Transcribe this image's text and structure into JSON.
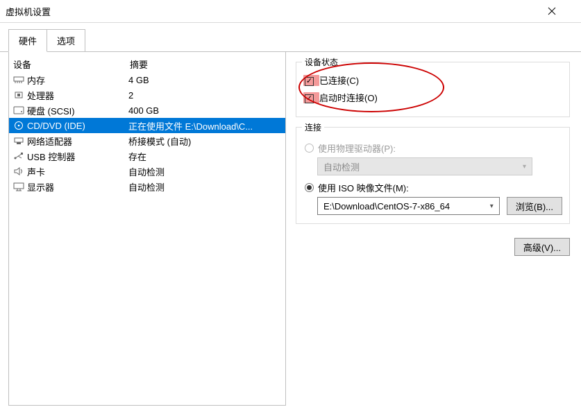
{
  "window": {
    "title": "虚拟机设置",
    "close_icon": "close-icon"
  },
  "tabs": {
    "hardware": "硬件",
    "options": "选项"
  },
  "left": {
    "columns": {
      "device": "设备",
      "summary": "摘要"
    },
    "rows": [
      {
        "icon": "memory-icon",
        "name": "内存",
        "summary": "4 GB"
      },
      {
        "icon": "cpu-icon",
        "name": "处理器",
        "summary": "2"
      },
      {
        "icon": "hdd-icon",
        "name": "硬盘 (SCSI)",
        "summary": "400 GB"
      },
      {
        "icon": "disc-icon",
        "name": "CD/DVD (IDE)",
        "summary": "正在使用文件 E:\\Download\\C..."
      },
      {
        "icon": "nic-icon",
        "name": "网络适配器",
        "summary": "桥接模式 (自动)"
      },
      {
        "icon": "usb-icon",
        "name": "USB 控制器",
        "summary": "存在"
      },
      {
        "icon": "sound-icon",
        "name": "声卡",
        "summary": "自动检测"
      },
      {
        "icon": "display-icon",
        "name": "显示器",
        "summary": "自动检测"
      }
    ],
    "selected_index": 3
  },
  "right": {
    "status_group": "设备状态",
    "connected_label": "已连接(C)",
    "connect_power_label": "启动时连接(O)",
    "connected_checked": true,
    "connect_power_checked": true,
    "connection_group": "连接",
    "use_physical_label": "使用物理驱动器(P):",
    "use_physical_checked": false,
    "physical_select_value": "自动检测",
    "use_iso_label": "使用 ISO 映像文件(M):",
    "use_iso_checked": true,
    "iso_path": "E:\\Download\\CentOS-7-x86_64",
    "browse_label": "浏览(B)...",
    "advanced_label": "高级(V)..."
  }
}
